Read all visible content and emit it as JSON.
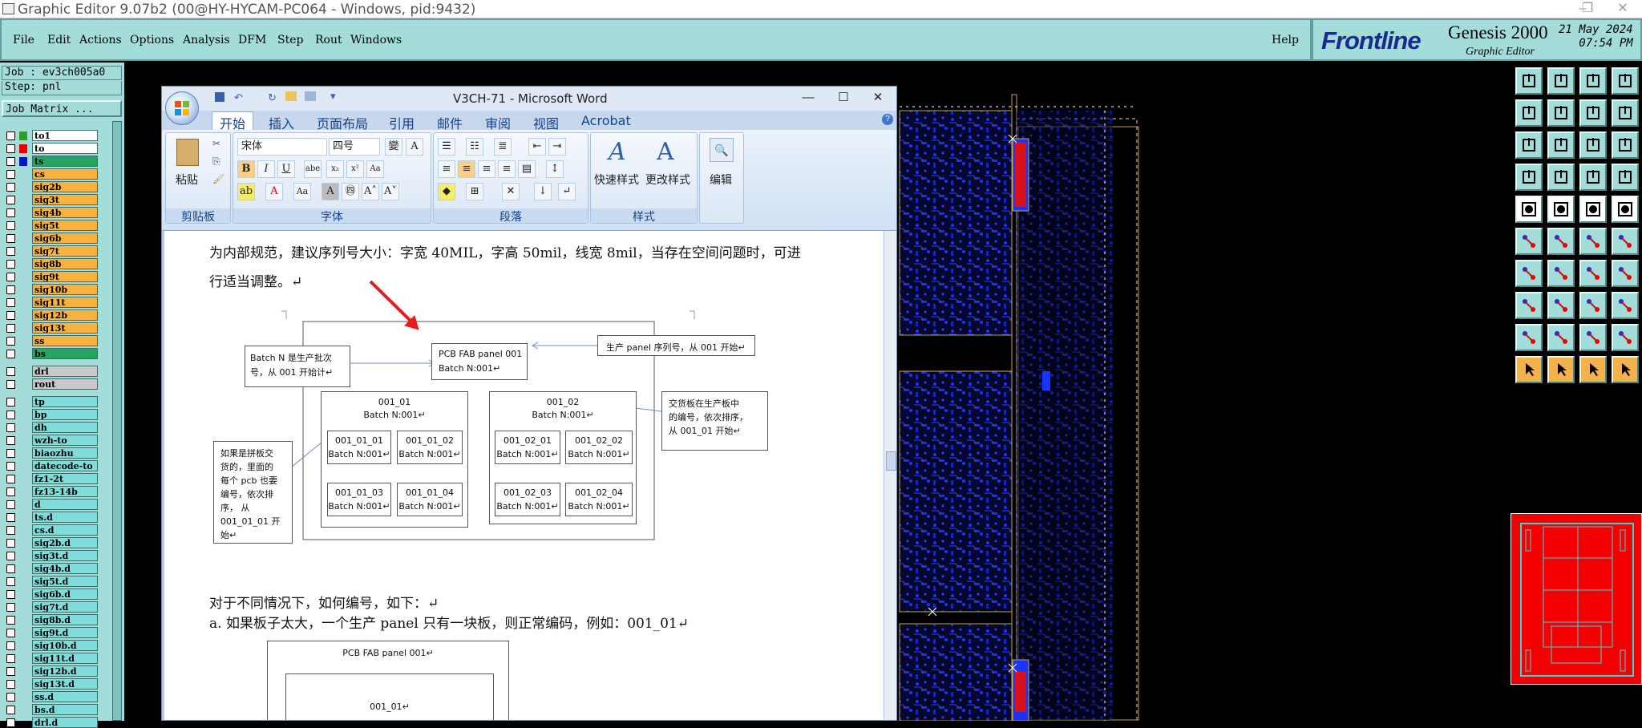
{
  "titlebar": {
    "title": "Graphic Editor 9.07b2 (00@HY-HYCAM-PC064 - Windows, pid:9432)"
  },
  "menu": [
    "File",
    "Edit",
    "Actions",
    "Options",
    "Analysis",
    "DFM",
    "Step",
    "Rout",
    "Windows"
  ],
  "help": "Help",
  "brand": {
    "logo": "Frontline",
    "product": "Genesis 2000",
    "subtitle": "Graphic Editor",
    "date": "21 May 2024",
    "time": "07:54 PM"
  },
  "job": {
    "job": "Job : ev3ch005a0",
    "step": "Step: pnl",
    "matrix": "Job Matrix ..."
  },
  "layers": [
    {
      "name": "to1",
      "color": "#ffffff",
      "dot": "#2c9e2c"
    },
    {
      "name": "to",
      "color": "#ffffff",
      "dot": "#e60000"
    },
    {
      "name": "ts",
      "color": "#25a561",
      "dot": "#0016c8"
    },
    {
      "name": "cs",
      "color": "#f6b13f"
    },
    {
      "name": "sig2b",
      "color": "#f6b13f"
    },
    {
      "name": "sig3t",
      "color": "#f6b13f"
    },
    {
      "name": "sig4b",
      "color": "#f6b13f"
    },
    {
      "name": "sig5t",
      "color": "#f6b13f"
    },
    {
      "name": "sig6b",
      "color": "#f6b13f"
    },
    {
      "name": "sig7t",
      "color": "#f6b13f"
    },
    {
      "name": "sig8b",
      "color": "#f6b13f"
    },
    {
      "name": "sig9t",
      "color": "#f6b13f"
    },
    {
      "name": "sig10b",
      "color": "#f6b13f"
    },
    {
      "name": "sig11t",
      "color": "#f6b13f"
    },
    {
      "name": "sig12b",
      "color": "#f6b13f"
    },
    {
      "name": "sig13t",
      "color": "#f6b13f"
    },
    {
      "name": "ss",
      "color": "#f6b13f"
    },
    {
      "name": "bs",
      "color": "#25a561"
    },
    {
      "name": "drl",
      "color": "#c8c8c8"
    },
    {
      "name": "rout",
      "color": "#c8c8c8"
    },
    {
      "name": "tp",
      "color": "#7fdcd8"
    },
    {
      "name": "bp",
      "color": "#7fdcd8"
    },
    {
      "name": "dh",
      "color": "#7fdcd8"
    },
    {
      "name": "wzh-to",
      "color": "#7fdcd8"
    },
    {
      "name": "biaozhu",
      "color": "#7fdcd8"
    },
    {
      "name": "datecode-to",
      "color": "#7fdcd8"
    },
    {
      "name": "fz1-2t",
      "color": "#7fdcd8"
    },
    {
      "name": "fz13-14b",
      "color": "#7fdcd8"
    },
    {
      "name": "d",
      "color": "#7fdcd8"
    },
    {
      "name": "ts.d",
      "color": "#7fdcd8"
    },
    {
      "name": "cs.d",
      "color": "#7fdcd8"
    },
    {
      "name": "sig2b.d",
      "color": "#7fdcd8"
    },
    {
      "name": "sig3t.d",
      "color": "#7fdcd8"
    },
    {
      "name": "sig4b.d",
      "color": "#7fdcd8"
    },
    {
      "name": "sig5t.d",
      "color": "#7fdcd8"
    },
    {
      "name": "sig6b.d",
      "color": "#7fdcd8"
    },
    {
      "name": "sig7t.d",
      "color": "#7fdcd8"
    },
    {
      "name": "sig8b.d",
      "color": "#7fdcd8"
    },
    {
      "name": "sig9t.d",
      "color": "#7fdcd8"
    },
    {
      "name": "sig10b.d",
      "color": "#7fdcd8"
    },
    {
      "name": "sig11t.d",
      "color": "#7fdcd8"
    },
    {
      "name": "sig12b.d",
      "color": "#7fdcd8"
    },
    {
      "name": "sig13t.d",
      "color": "#7fdcd8"
    },
    {
      "name": "ss.d",
      "color": "#7fdcd8"
    },
    {
      "name": "bs.d",
      "color": "#7fdcd8"
    },
    {
      "name": "drl.d",
      "color": "#7fdcd8"
    }
  ],
  "word": {
    "title": "V3CH-71 - Microsoft Word",
    "tabs": [
      "开始",
      "插入",
      "页面布局",
      "引用",
      "邮件",
      "审阅",
      "视图",
      "Acrobat"
    ],
    "groups": {
      "clipboard": "剪贴板",
      "font": "字体",
      "paragraph": "段落",
      "styles": "样式",
      "edit": "编辑"
    },
    "paste": "粘贴",
    "font_name": "宋体",
    "font_size": "四号",
    "quick_style": "快速样式",
    "change_style": "更改样式",
    "edit_btn": "编辑",
    "doc": {
      "p1a": "为内部规范，建议序列号大小：字宽 40MIL，字高 50mil，线宽 8mil，当存在空间问题时，可进",
      "p1b": "行适当调整。↵",
      "batch_note_1": "Batch N 是生产批次",
      "batch_note_2": "号，从 001 开始计↵",
      "pcb_fab": "PCB FAB panel 001",
      "batch_n001": "Batch N:001↵",
      "serial_note": "生产 panel 序列号，从 001 开始↵",
      "p001_01": "001_01",
      "p001_02": "001_02",
      "batch_n001b": "Batch N:001↵",
      "cell_01_01": "001_01_01",
      "cell_01_02": "001_01_02",
      "cell_01_03": "001_01_03",
      "cell_01_04": "001_01_04",
      "cell_02_01": "001_02_01",
      "cell_02_02": "001_02_02",
      "cell_02_03": "001_02_03",
      "cell_02_04": "001_02_04",
      "cell_batch": "Batch N:001↵",
      "delivery_note_1": "交货板在生产板中",
      "delivery_note_2": "的编号，依次排序，",
      "delivery_note_3": "从 001_01 开始↵",
      "left_note_1": "如果是拼板交",
      "left_note_2": "货的，里面的",
      "left_note_3": "每个 pcb 也要",
      "left_note_4": "编号，依次排",
      "left_note_5": "序，    从",
      "left_note_6": "001_01_01 开",
      "left_note_7": "始↵",
      "p2": "对于不同情况下，如何编号，如下：↵",
      "p3": "a.  如果板子太大，一个生产 panel 只有一块板，则正常编码，例如：001_01↵",
      "fig2_title": "PCB FAB panel 001↵",
      "fig2_inner": "001_01↵"
    }
  }
}
